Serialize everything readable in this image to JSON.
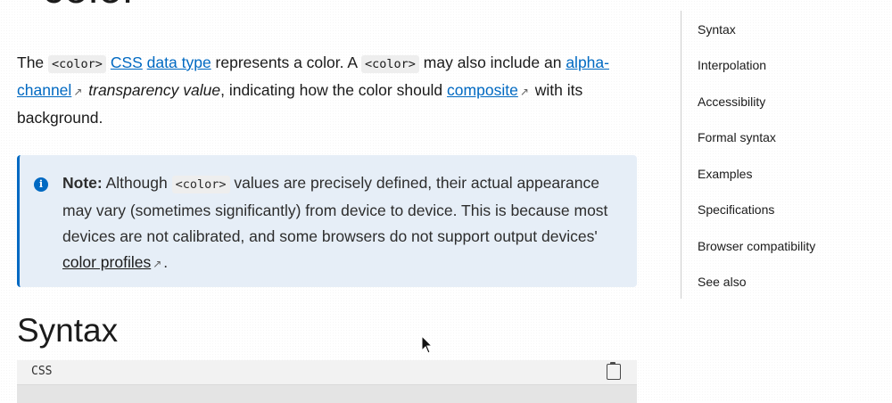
{
  "page_title": "<color>",
  "intro": {
    "the": "The",
    "code1": "<color>",
    "link_css": "CSS",
    "link_data_type": "data type",
    "text1": "represents a color. A",
    "code2": "<color>",
    "text2": "may also include an",
    "link_alpha": "alpha-channel",
    "text3_em": "transparency value",
    "text4": ", indicating how the color should",
    "link_composite": "composite",
    "text5": "with its background."
  },
  "note": {
    "label": "Note:",
    "text1": "Although",
    "code": "<color>",
    "text2": "values are precisely defined, their actual appearance may vary (sometimes significantly) from device to device. This is because most devices are not calibrated, and some browsers do not support output devices'",
    "link": "color profiles",
    "end": "."
  },
  "syntax_heading": "Syntax",
  "code_lang": "CSS",
  "toc": [
    "Syntax",
    "Interpolation",
    "Accessibility",
    "Formal syntax",
    "Examples",
    "Specifications",
    "Browser compatibility",
    "See also"
  ],
  "colors": {
    "link": "#0069c2",
    "note_bg": "#e6eef7",
    "accent": "#0069c2"
  }
}
